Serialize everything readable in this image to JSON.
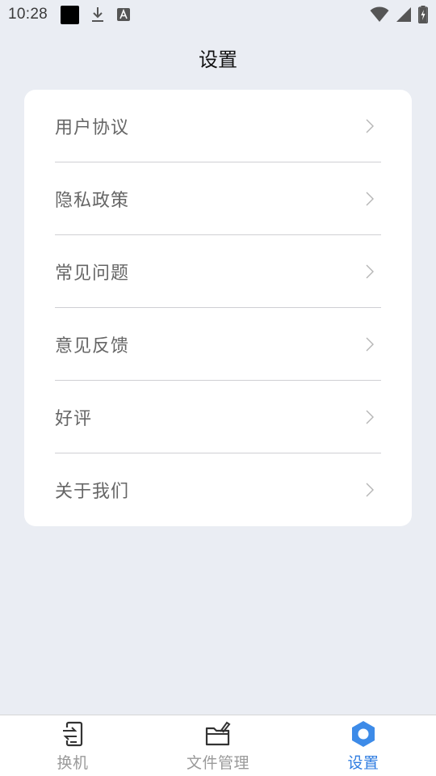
{
  "status_bar": {
    "time": "10:28",
    "icons": [
      "notification-square-icon",
      "download-icon",
      "font-a-icon",
      "wifi-icon",
      "signal-icon",
      "battery-charging-icon"
    ]
  },
  "header": {
    "title": "设置"
  },
  "settings": {
    "items": [
      {
        "label": "用户协议",
        "icon": "chevron-right-icon"
      },
      {
        "label": "隐私政策",
        "icon": "chevron-right-icon"
      },
      {
        "label": "常见问题",
        "icon": "chevron-right-icon"
      },
      {
        "label": "意见反馈",
        "icon": "chevron-right-icon"
      },
      {
        "label": "好评",
        "icon": "chevron-right-icon"
      },
      {
        "label": "关于我们",
        "icon": "chevron-right-icon"
      }
    ]
  },
  "bottom_nav": {
    "tabs": [
      {
        "label": "换机",
        "icon": "phone-transfer-icon",
        "active": false
      },
      {
        "label": "文件管理",
        "icon": "folder-icon",
        "active": false
      },
      {
        "label": "设置",
        "icon": "settings-hexagon-icon",
        "active": true
      }
    ]
  },
  "colors": {
    "background": "#eaedf3",
    "card": "#ffffff",
    "accent": "#2f7de1",
    "inactive_tab": "#9a9a9a",
    "item_text": "#666666"
  }
}
